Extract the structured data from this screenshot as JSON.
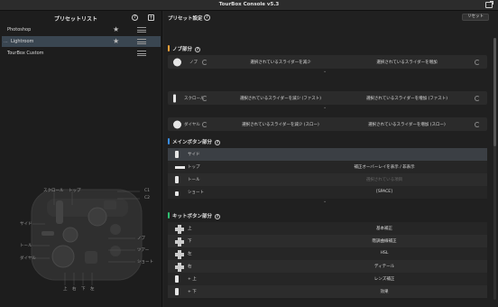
{
  "app": {
    "title": "TourBox Console v5.3"
  },
  "left": {
    "title": "プリセットリスト",
    "presets": [
      {
        "name": "Photoshop"
      },
      {
        "name": "Lightroom",
        "selected": true
      },
      {
        "name": "TourBox Custom"
      }
    ],
    "device_labels": {
      "scroll": "スクロール",
      "top": "トップ",
      "c1": "C1",
      "c2": "C2",
      "side": "サイド",
      "knob": "ノブ",
      "tall": "トール",
      "dial": "ダイヤル",
      "short": "ショート",
      "tour": "ツアー",
      "u": "上",
      "d": "右",
      "l": "下",
      "r": "左"
    }
  },
  "right": {
    "title": "プリセット設定",
    "reset_label": "リセット",
    "knob_section": {
      "title": "ノブ部分",
      "color": "#f5a23a",
      "rows": [
        {
          "label": "ノブ",
          "left": "選択されているスライダーを減少",
          "right": "選択されているスライダーを増加"
        },
        {
          "label": "スクロール",
          "left": "選択されているスライダーを減少 (ファスト)",
          "right": "選択されているスライダーを増加 (ファスト)"
        },
        {
          "label": "ダイヤル",
          "left": "選択されているスライダーを減少 (スロー)",
          "right": "選択されているスライダーを増加 (スロー)"
        }
      ]
    },
    "main_section": {
      "title": "メインボタン部分",
      "color": "#3a8ee6",
      "rows": [
        {
          "label": "サイド",
          "value": ""
        },
        {
          "label": "トップ",
          "value": "補正オーバーレイを表示 / 非表示"
        },
        {
          "label": "トール",
          "value": "選択されている項目",
          "dim": true
        },
        {
          "label": "ショート",
          "value": "[SPACE]"
        }
      ]
    },
    "kit_section": {
      "title": "キットボタン部分",
      "color": "#2fbf71",
      "rows": [
        {
          "label": "上",
          "value": "基本補正"
        },
        {
          "label": "下",
          "value": "階調曲線補正"
        },
        {
          "label": "左",
          "value": "HSL"
        },
        {
          "label": "右",
          "value": "ディテール"
        },
        {
          "label": "+ 上",
          "value": "レンズ補正"
        },
        {
          "label": "+ 下",
          "value": "効果"
        }
      ]
    }
  }
}
